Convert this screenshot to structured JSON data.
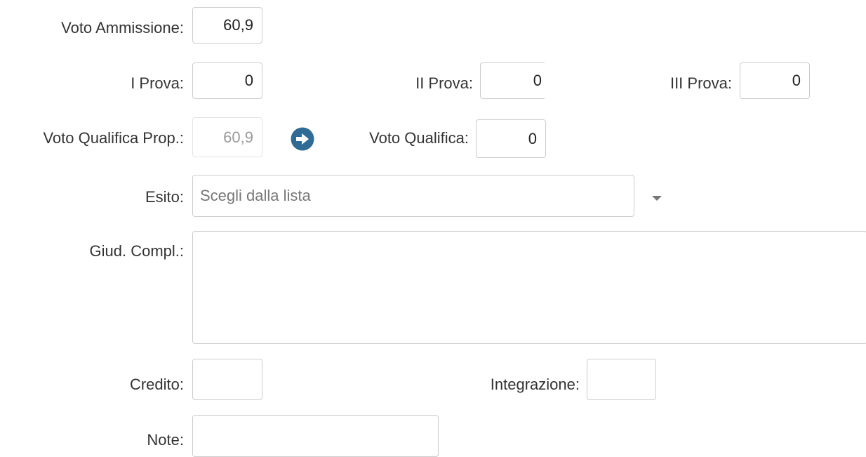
{
  "form": {
    "voto_ammissione": {
      "label": "Voto Ammissione:",
      "value": "60,9"
    },
    "prova_1": {
      "label": "I Prova:",
      "value": "0"
    },
    "prova_2": {
      "label": "II Prova:",
      "value": "0"
    },
    "prova_3": {
      "label": "III Prova:",
      "value": "0"
    },
    "voto_qualifica_prop": {
      "label": "Voto Qualifica Prop.:",
      "value": "60,9"
    },
    "copy_arrow": {
      "icon": "arrow-right-circle-icon",
      "color": "#2f6b94"
    },
    "voto_qualifica": {
      "label": "Voto Qualifica:",
      "value": "0"
    },
    "esito": {
      "label": "Esito:",
      "placeholder": "Scegli dalla lista"
    },
    "giud_compl": {
      "label": "Giud. Compl.:",
      "value": ""
    },
    "credito": {
      "label": "Credito:",
      "value": ""
    },
    "integrazione": {
      "label": "Integrazione:",
      "value": ""
    },
    "note": {
      "label": "Note:",
      "value": ""
    }
  }
}
